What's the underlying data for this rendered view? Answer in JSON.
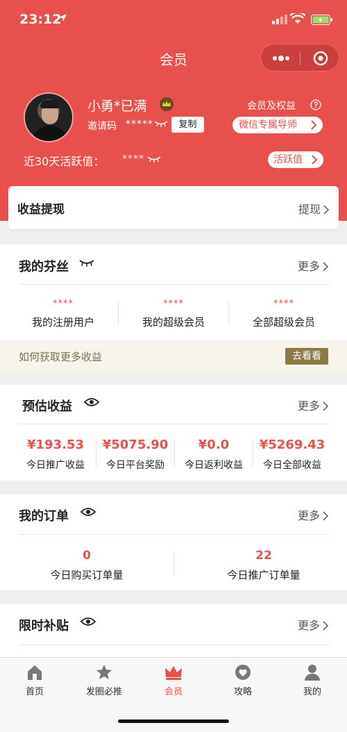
{
  "status_bar": {
    "time": "23:12"
  },
  "nav": {
    "title": "会员"
  },
  "profile": {
    "name": "小勇*已满",
    "invite_label": "邀请码",
    "invite_code": "*****",
    "copy_label": "复制",
    "member_rights_label": "会员及权益",
    "mentor_button": "微信专属导师",
    "activity_label": "近30天活跃值：",
    "activity_value": "****",
    "activity_button": "活跃值"
  },
  "withdraw": {
    "title": "收益提现",
    "link": "提现"
  },
  "fans": {
    "title": "我的芬丝",
    "more": "更多",
    "stats": [
      {
        "value": "****",
        "label": "我的注册用户"
      },
      {
        "value": "****",
        "label": "我的超级会员"
      },
      {
        "value": "****",
        "label": "全部超级会员"
      }
    ],
    "promo_text": "如何获取更多收益",
    "promo_button": "去看看"
  },
  "earnings": {
    "title": "预估收益",
    "more": "更多",
    "stats": [
      {
        "value": "¥193.53",
        "label": "今日推广收益"
      },
      {
        "value": "¥5075.90",
        "label": "今日平台奖励"
      },
      {
        "value": "¥0.0",
        "label": "今日返利收益"
      },
      {
        "value": "¥5269.43",
        "label": "今日全部收益"
      }
    ]
  },
  "orders": {
    "title": "我的订单",
    "more": "更多",
    "stats": [
      {
        "value": "0",
        "label": "今日购买订单量"
      },
      {
        "value": "22",
        "label": "今日推广订单量"
      }
    ]
  },
  "subsidy": {
    "title": "限时补贴",
    "more": "更多"
  },
  "tabs": [
    {
      "label": "首页",
      "icon": "home-icon"
    },
    {
      "label": "发圈必推",
      "icon": "star-icon"
    },
    {
      "label": "会员",
      "icon": "crown-icon",
      "active": true
    },
    {
      "label": "攻略",
      "icon": "heart-icon"
    },
    {
      "label": "我的",
      "icon": "person-icon"
    }
  ],
  "colors": {
    "brand": "#e8504d",
    "gold": "#8b7a45"
  }
}
